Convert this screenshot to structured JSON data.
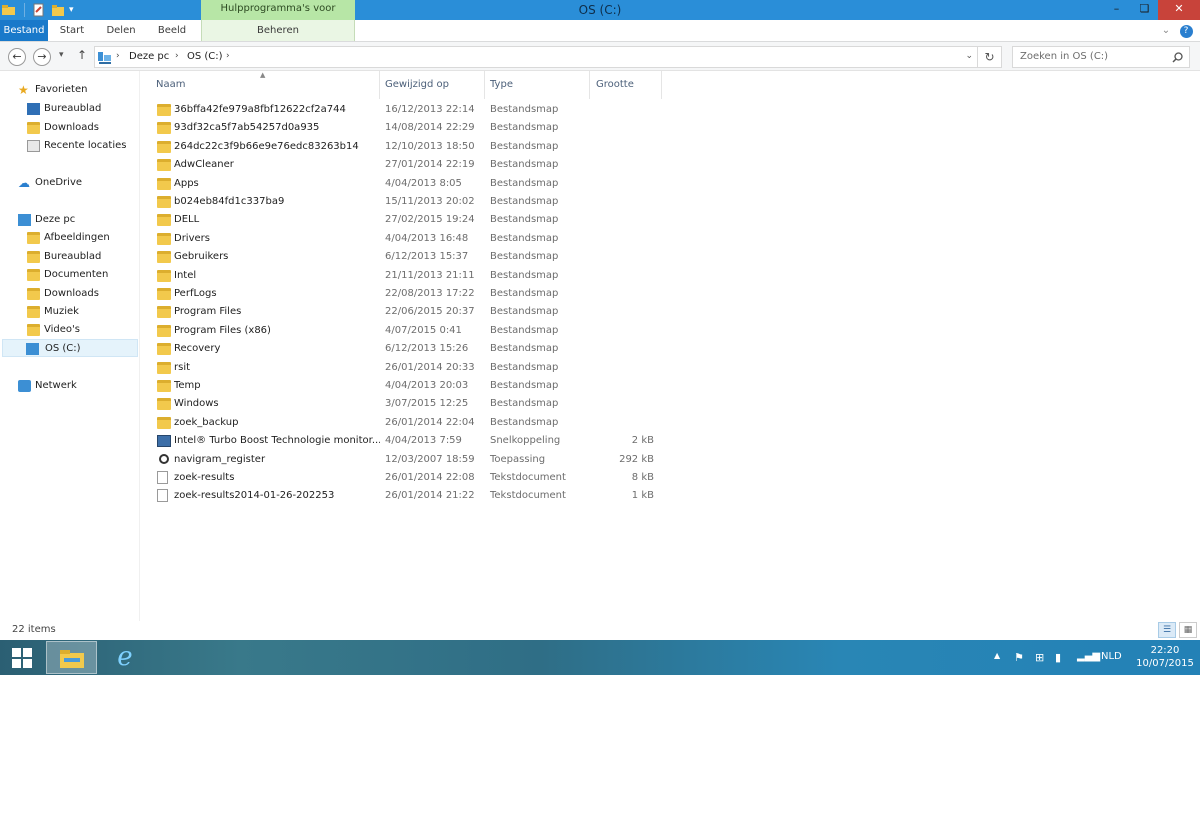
{
  "window": {
    "title": "OS (C:)",
    "tools_tab_title": "Hulpprogramma's voor stations",
    "minimize_symbol": "–",
    "maximize_symbol": "❏",
    "close_symbol": "✕"
  },
  "ribbon": {
    "tabs": [
      "Bestand",
      "Start",
      "Delen",
      "Beeld"
    ],
    "context_tab": "Beheren",
    "help_symbol": "?"
  },
  "address": {
    "segments": [
      "Deze pc",
      "OS (C:)"
    ],
    "separator": "›",
    "search_placeholder": "Zoeken in OS (C:)"
  },
  "nav": {
    "favorites": {
      "label": "Favorieten",
      "items": [
        "Bureaublad",
        "Downloads",
        "Recente locaties"
      ]
    },
    "onedrive": "OneDrive",
    "thispc": {
      "label": "Deze pc",
      "items": [
        "Afbeeldingen",
        "Bureaublad",
        "Documenten",
        "Downloads",
        "Muziek",
        "Video's",
        "OS (C:)"
      ]
    },
    "network": "Netwerk"
  },
  "columns": {
    "name": "Naam",
    "modified": "Gewijzigd op",
    "type": "Type",
    "size": "Grootte"
  },
  "files": [
    {
      "name": "36bffa42fe979a8fbf12622cf2a744",
      "date": "16/12/2013 22:14",
      "type": "Bestandsmap",
      "size": "",
      "icon": "folder"
    },
    {
      "name": "93df32ca5f7ab54257d0a935",
      "date": "14/08/2014 22:29",
      "type": "Bestandsmap",
      "size": "",
      "icon": "folder"
    },
    {
      "name": "264dc22c3f9b66e9e76edc83263b14",
      "date": "12/10/2013 18:50",
      "type": "Bestandsmap",
      "size": "",
      "icon": "folder"
    },
    {
      "name": "AdwCleaner",
      "date": "27/01/2014 22:19",
      "type": "Bestandsmap",
      "size": "",
      "icon": "folder"
    },
    {
      "name": "Apps",
      "date": "4/04/2013 8:05",
      "type": "Bestandsmap",
      "size": "",
      "icon": "folder"
    },
    {
      "name": "b024eb84fd1c337ba9",
      "date": "15/11/2013 20:02",
      "type": "Bestandsmap",
      "size": "",
      "icon": "folder"
    },
    {
      "name": "DELL",
      "date": "27/02/2015 19:24",
      "type": "Bestandsmap",
      "size": "",
      "icon": "folder"
    },
    {
      "name": "Drivers",
      "date": "4/04/2013 16:48",
      "type": "Bestandsmap",
      "size": "",
      "icon": "folder"
    },
    {
      "name": "Gebruikers",
      "date": "6/12/2013 15:37",
      "type": "Bestandsmap",
      "size": "",
      "icon": "folder"
    },
    {
      "name": "Intel",
      "date": "21/11/2013 21:11",
      "type": "Bestandsmap",
      "size": "",
      "icon": "folder"
    },
    {
      "name": "PerfLogs",
      "date": "22/08/2013 17:22",
      "type": "Bestandsmap",
      "size": "",
      "icon": "folder"
    },
    {
      "name": "Program Files",
      "date": "22/06/2015 20:37",
      "type": "Bestandsmap",
      "size": "",
      "icon": "folder"
    },
    {
      "name": "Program Files (x86)",
      "date": "4/07/2015 0:41",
      "type": "Bestandsmap",
      "size": "",
      "icon": "folder"
    },
    {
      "name": "Recovery",
      "date": "6/12/2013 15:26",
      "type": "Bestandsmap",
      "size": "",
      "icon": "folder"
    },
    {
      "name": "rsit",
      "date": "26/01/2014 20:33",
      "type": "Bestandsmap",
      "size": "",
      "icon": "folder"
    },
    {
      "name": "Temp",
      "date": "4/04/2013 20:03",
      "type": "Bestandsmap",
      "size": "",
      "icon": "folder"
    },
    {
      "name": "Windows",
      "date": "3/07/2015 12:25",
      "type": "Bestandsmap",
      "size": "",
      "icon": "folder"
    },
    {
      "name": "zoek_backup",
      "date": "26/01/2014 22:04",
      "type": "Bestandsmap",
      "size": "",
      "icon": "folder"
    },
    {
      "name": "Intel® Turbo Boost Technologie monitor...",
      "date": "4/04/2013 7:59",
      "type": "Snelkoppeling",
      "size": "2 kB",
      "icon": "shortcut"
    },
    {
      "name": "navigram_register",
      "date": "12/03/2007 18:59",
      "type": "Toepassing",
      "size": "292 kB",
      "icon": "app"
    },
    {
      "name": "zoek-results",
      "date": "26/01/2014 22:08",
      "type": "Tekstdocument",
      "size": "8 kB",
      "icon": "text"
    },
    {
      "name": "zoek-results2014-01-26-202253",
      "date": "26/01/2014 21:22",
      "type": "Tekstdocument",
      "size": "1 kB",
      "icon": "text"
    }
  ],
  "status": {
    "count": "22 items"
  },
  "taskbar": {
    "language": "NLD",
    "time": "22:20",
    "date": "10/07/2015"
  }
}
